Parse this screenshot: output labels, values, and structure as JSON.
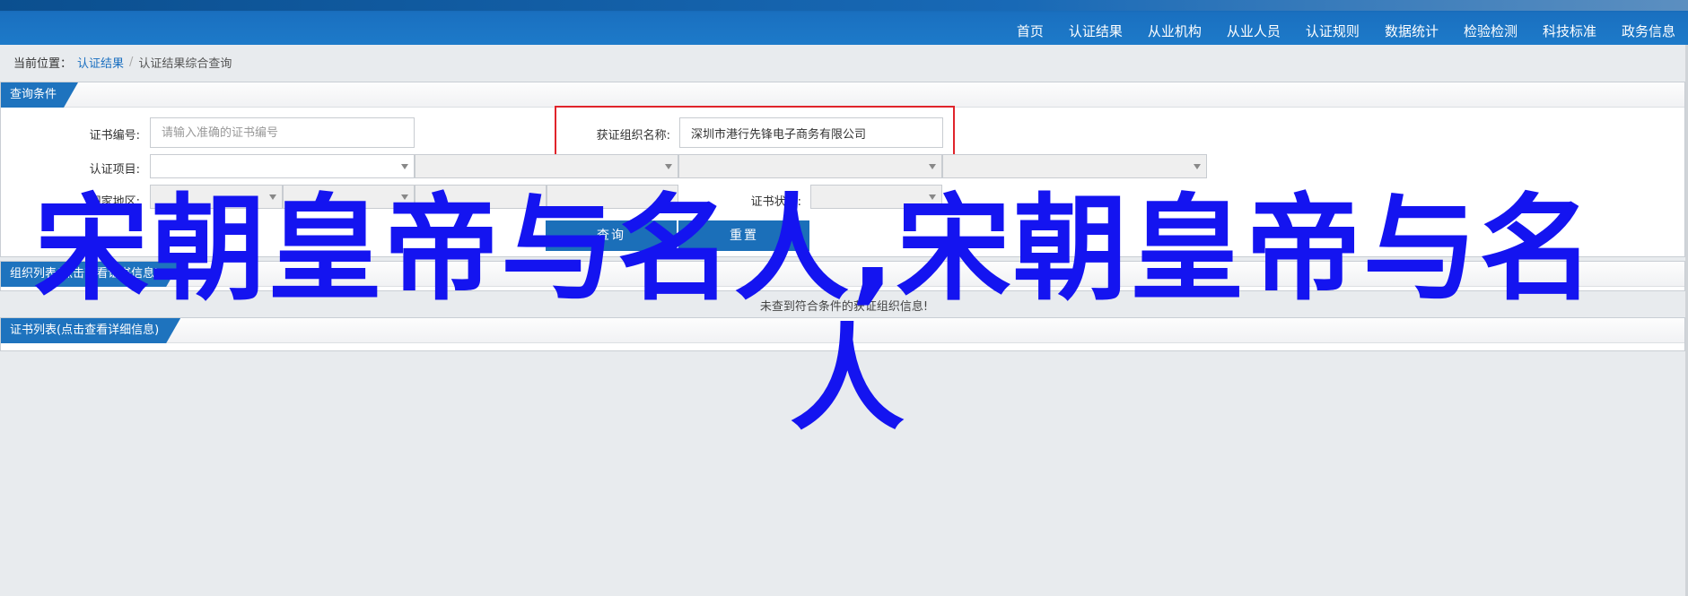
{
  "nav": {
    "items": [
      {
        "label": "首页"
      },
      {
        "label": "认证结果"
      },
      {
        "label": "从业机构"
      },
      {
        "label": "从业人员"
      },
      {
        "label": "认证规则"
      },
      {
        "label": "数据统计"
      },
      {
        "label": "检验检测"
      },
      {
        "label": "科技标准"
      },
      {
        "label": "政务信息"
      }
    ]
  },
  "breadcrumb": {
    "prefix": "当前位置：",
    "link": "认证结果",
    "separator": "/",
    "current": "认证结果综合查询"
  },
  "query_panel": {
    "title": "查询条件",
    "cert_no_label": "证书编号:",
    "cert_no_placeholder": "请输入准确的证书编号",
    "org_name_label": "获证组织名称:",
    "org_name_value": "深圳市港行先锋电子商务有限公司",
    "project_label": "认证项目:",
    "region_label": "国家地区:",
    "status_label": "证书状态:",
    "search_button": "查询",
    "reset_button": "重置"
  },
  "org_panel": {
    "title": "组织列表(点击查看证书信息)",
    "empty_message": "未查到符合条件的获证组织信息!"
  },
  "cert_panel": {
    "title": "证书列表(点击查看详细信息)"
  },
  "overlay": {
    "line1": "宋朝皇帝与名人,宋朝皇帝与名",
    "line2": "人",
    "color": "#1414f0"
  },
  "colors": {
    "brand_blue": "#1e73be",
    "highlight_red": "#e0242b"
  }
}
